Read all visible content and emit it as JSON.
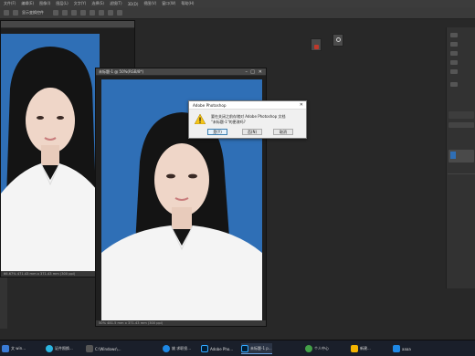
{
  "menu": {
    "items": [
      "文件(F)",
      "编辑(E)",
      "图像(I)",
      "图层(L)",
      "文字(Y)",
      "选择(S)",
      "滤镜(T)",
      "3D(D)",
      "视图(V)",
      "窗口(W)",
      "帮助(H)"
    ]
  },
  "options": {
    "label": "显示变换控件"
  },
  "left_doc": {
    "title": "",
    "status": "66.67% 471.43 mm x 371.43 mm (300 ppi)"
  },
  "front_doc": {
    "title": "未标题-1 @ 50%(RGB/8*)",
    "status": "50% 481.5 mm x 371.43 mm (300 ppi)"
  },
  "dialog": {
    "title": "Adobe Photoshop",
    "message_line1": "要在关闭之前存储对 Adobe Photoshop 文档",
    "message_line2": "\"未标题-1\"的更改吗?",
    "yes_label": "是(Y)",
    "no_label": "否(N)",
    "cancel_label": "取消",
    "close_label": "✕"
  },
  "taskbar": {
    "items": [
      {
        "label": "文 win...",
        "color": "#3a7bd5"
      },
      {
        "label": "证件照换...",
        "color": "#2bb5e0"
      },
      {
        "label": "C:\\Windows\\...",
        "color": "#555"
      },
      {
        "label": "姚 求职投...",
        "color": "#1e88e5"
      },
      {
        "label": "Adobe Pho...",
        "color": "#31a8ff"
      },
      {
        "label": "未标题-1 p...",
        "color": "#31a8ff"
      },
      {
        "label": "个人中心",
        "color": "#43a047"
      },
      {
        "label": "新建...",
        "color": "#f4b400"
      },
      {
        "label": "aaaa",
        "color": "#1e88e5"
      }
    ]
  },
  "colors": {
    "photo_bg": "#2f6fb6",
    "accent": "#31a8ff"
  }
}
